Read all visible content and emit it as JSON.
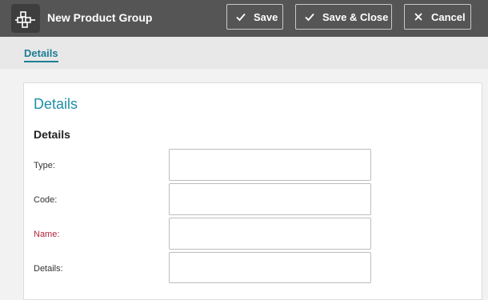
{
  "header": {
    "title": "New Product Group",
    "app_icon": "product-group-icon",
    "buttons": {
      "save": {
        "label": "Save",
        "icon": "check-icon"
      },
      "save_close": {
        "label": "Save & Close",
        "icon": "check-icon"
      },
      "cancel": {
        "label": "Cancel",
        "icon": "close-icon"
      }
    }
  },
  "tabs": [
    {
      "label": "Details",
      "active": true
    }
  ],
  "panel": {
    "title": "Details",
    "section_title": "Details",
    "fields": [
      {
        "label": "Type:",
        "value": "",
        "required": false
      },
      {
        "label": "Code:",
        "value": "",
        "required": false
      },
      {
        "label": "Name:",
        "value": "",
        "required": true
      },
      {
        "label": "Details:",
        "value": "",
        "required": false
      }
    ]
  },
  "colors": {
    "header_bg": "#555555",
    "accent": "#1e8fa8",
    "required_label": "#b0233a"
  }
}
